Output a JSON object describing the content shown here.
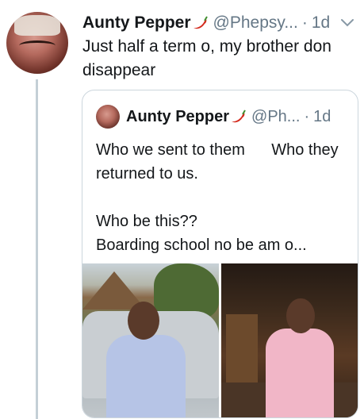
{
  "tweet": {
    "display_name": "Aunty Pepper",
    "handle": "@Phepsy...",
    "separator": "·",
    "time": "1d",
    "text": "Just half a term o, my brother don disappear"
  },
  "quoted_tweet": {
    "display_name": "Aunty Pepper",
    "handle": "@Ph...",
    "separator": "·",
    "time": "1d",
    "line1": "Who we sent to them      Who they returned to us.",
    "line2": "Who be this??",
    "line3": "Boarding school no be am o..."
  },
  "icons": {
    "name_emoji": "hot-pepper-icon",
    "menu": "chevron-down-icon"
  },
  "colors": {
    "text": "#14171a",
    "secondary": "#657786",
    "border": "#ccd6dd",
    "thread_line": "#c4cfd6"
  }
}
